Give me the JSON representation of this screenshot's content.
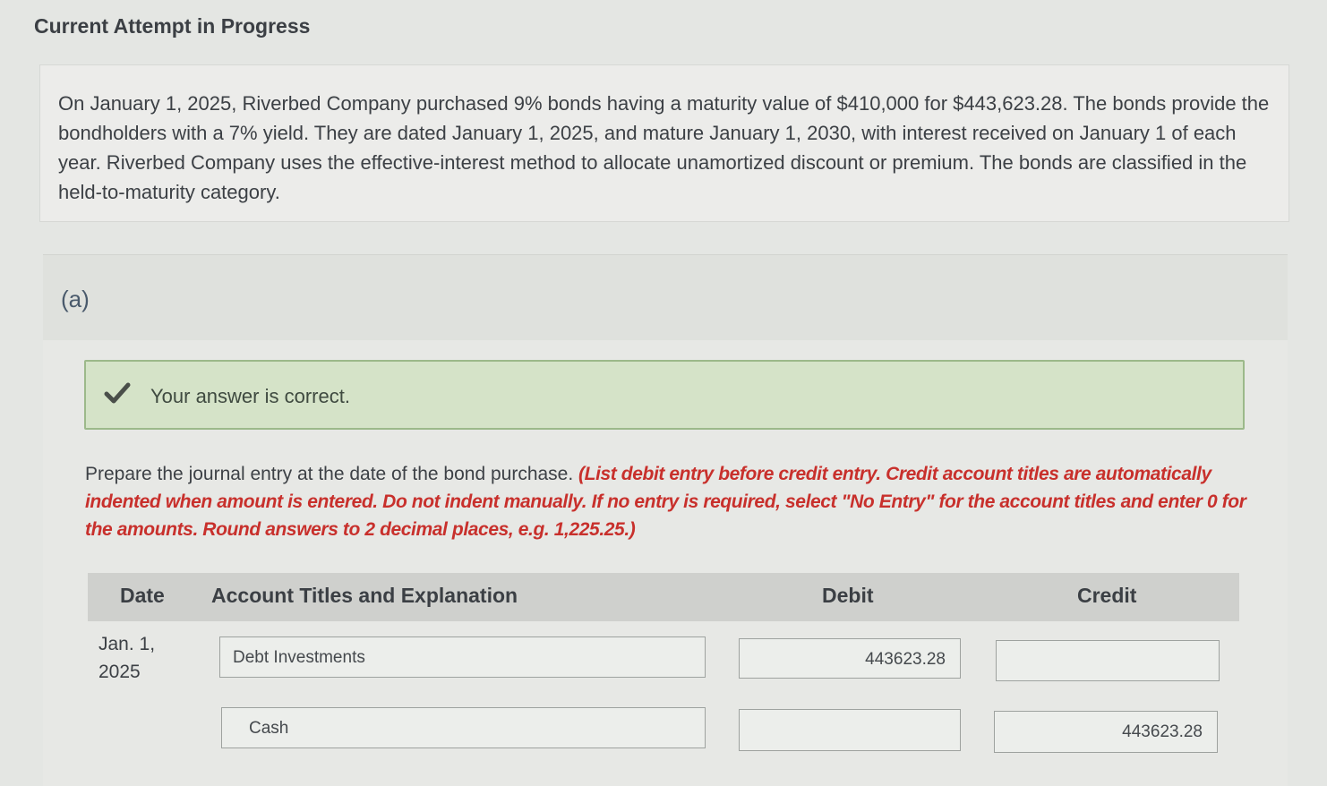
{
  "header": {
    "title": "Current Attempt in Progress"
  },
  "question": {
    "text": "On January 1, 2025, Riverbed Company purchased 9% bonds having a maturity value of $410,000 for $443,623.28. The bonds provide the bondholders with a 7% yield. They are dated January 1, 2025, and mature January 1, 2030, with interest received on January 1 of each year. Riverbed Company uses the effective-interest method to allocate unamortized discount or premium. The bonds are classified in the held-to-maturity category."
  },
  "part": {
    "label": "(a)"
  },
  "feedback": {
    "icon": "checkmark-icon",
    "text": "Your answer is correct."
  },
  "instructions": {
    "plain": "Prepare the journal entry at the date of the bond purchase. ",
    "emphasis": "(List debit entry before credit entry. Credit account titles are automatically indented when amount is entered. Do not indent manually. If no entry is required, select \"No Entry\" for the account titles and enter 0 for the amounts. Round answers to 2 decimal places, e.g. 1,225.25.)"
  },
  "table": {
    "headers": {
      "date": "Date",
      "account": "Account Titles and Explanation",
      "debit": "Debit",
      "credit": "Credit"
    },
    "date_line1": "Jan. 1,",
    "date_line2": "2025",
    "rows": [
      {
        "account": "Debt Investments",
        "debit": "443623.28",
        "credit": ""
      },
      {
        "account": "Cash",
        "debit": "",
        "credit": "443623.28"
      }
    ]
  },
  "colors": {
    "success_bg": "#d5e3c8",
    "success_border": "#9cb98a",
    "instruction_red": "#c8302c"
  }
}
